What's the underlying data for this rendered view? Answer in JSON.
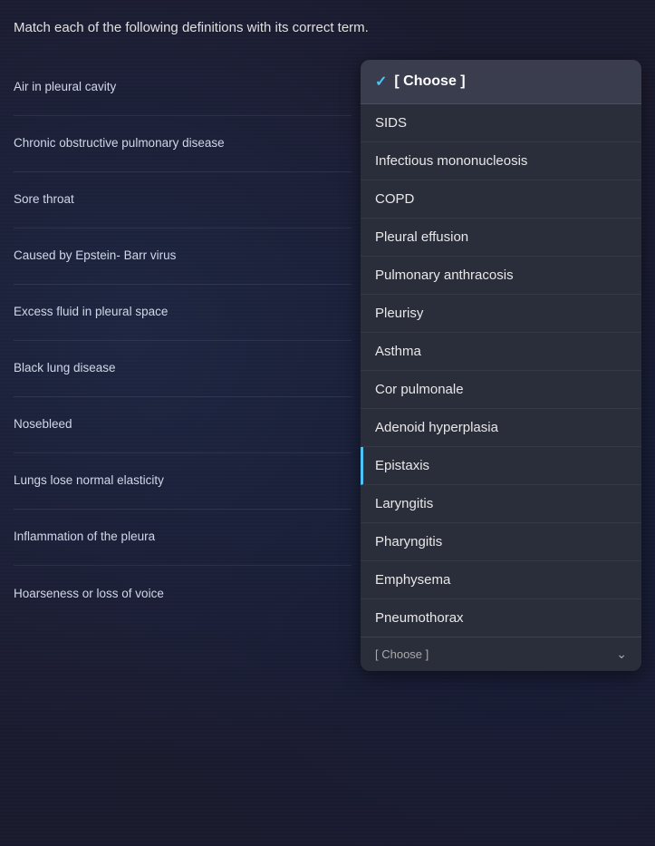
{
  "page": {
    "instruction": "Match each of the following definitions with its correct term."
  },
  "definitions": [
    {
      "id": "def-1",
      "text": "Air in pleural cavity"
    },
    {
      "id": "def-2",
      "text": "Chronic obstructive pulmonary disease"
    },
    {
      "id": "def-3",
      "text": "Sore throat"
    },
    {
      "id": "def-4",
      "text": "Caused by Epstein- Barr virus"
    },
    {
      "id": "def-5",
      "text": "Excess fluid in pleural space"
    },
    {
      "id": "def-6",
      "text": "Black lung disease"
    },
    {
      "id": "def-7",
      "text": "Nosebleed"
    },
    {
      "id": "def-8",
      "text": "Lungs lose normal elasticity"
    },
    {
      "id": "def-9",
      "text": "Inflammation of the pleura"
    },
    {
      "id": "def-10",
      "text": "Hoarseness or loss of voice"
    }
  ],
  "dropdown": {
    "header_checkmark": "✓",
    "header_label": "[ Choose ]",
    "options": [
      {
        "id": "opt-1",
        "text": "SIDS",
        "highlighted": false
      },
      {
        "id": "opt-2",
        "text": "Infectious mononucleosis",
        "highlighted": false
      },
      {
        "id": "opt-3",
        "text": "COPD",
        "highlighted": false
      },
      {
        "id": "opt-4",
        "text": "Pleural effusion",
        "highlighted": false
      },
      {
        "id": "opt-5",
        "text": "Pulmonary anthracosis",
        "highlighted": false
      },
      {
        "id": "opt-6",
        "text": "Pleurisy",
        "highlighted": false
      },
      {
        "id": "opt-7",
        "text": "Asthma",
        "highlighted": false
      },
      {
        "id": "opt-8",
        "text": "Cor pulmonale",
        "highlighted": false
      },
      {
        "id": "opt-9",
        "text": "Adenoid hyperplasia",
        "highlighted": false
      },
      {
        "id": "opt-10",
        "text": "Epistaxis",
        "highlighted": true
      },
      {
        "id": "opt-11",
        "text": "Laryngitis",
        "highlighted": false
      },
      {
        "id": "opt-12",
        "text": "Pharyngitis",
        "highlighted": false
      },
      {
        "id": "opt-13",
        "text": "Emphysema",
        "highlighted": false
      },
      {
        "id": "opt-14",
        "text": "Pneumothorax",
        "highlighted": false
      }
    ],
    "bottom_label": "[ Choose ]"
  }
}
